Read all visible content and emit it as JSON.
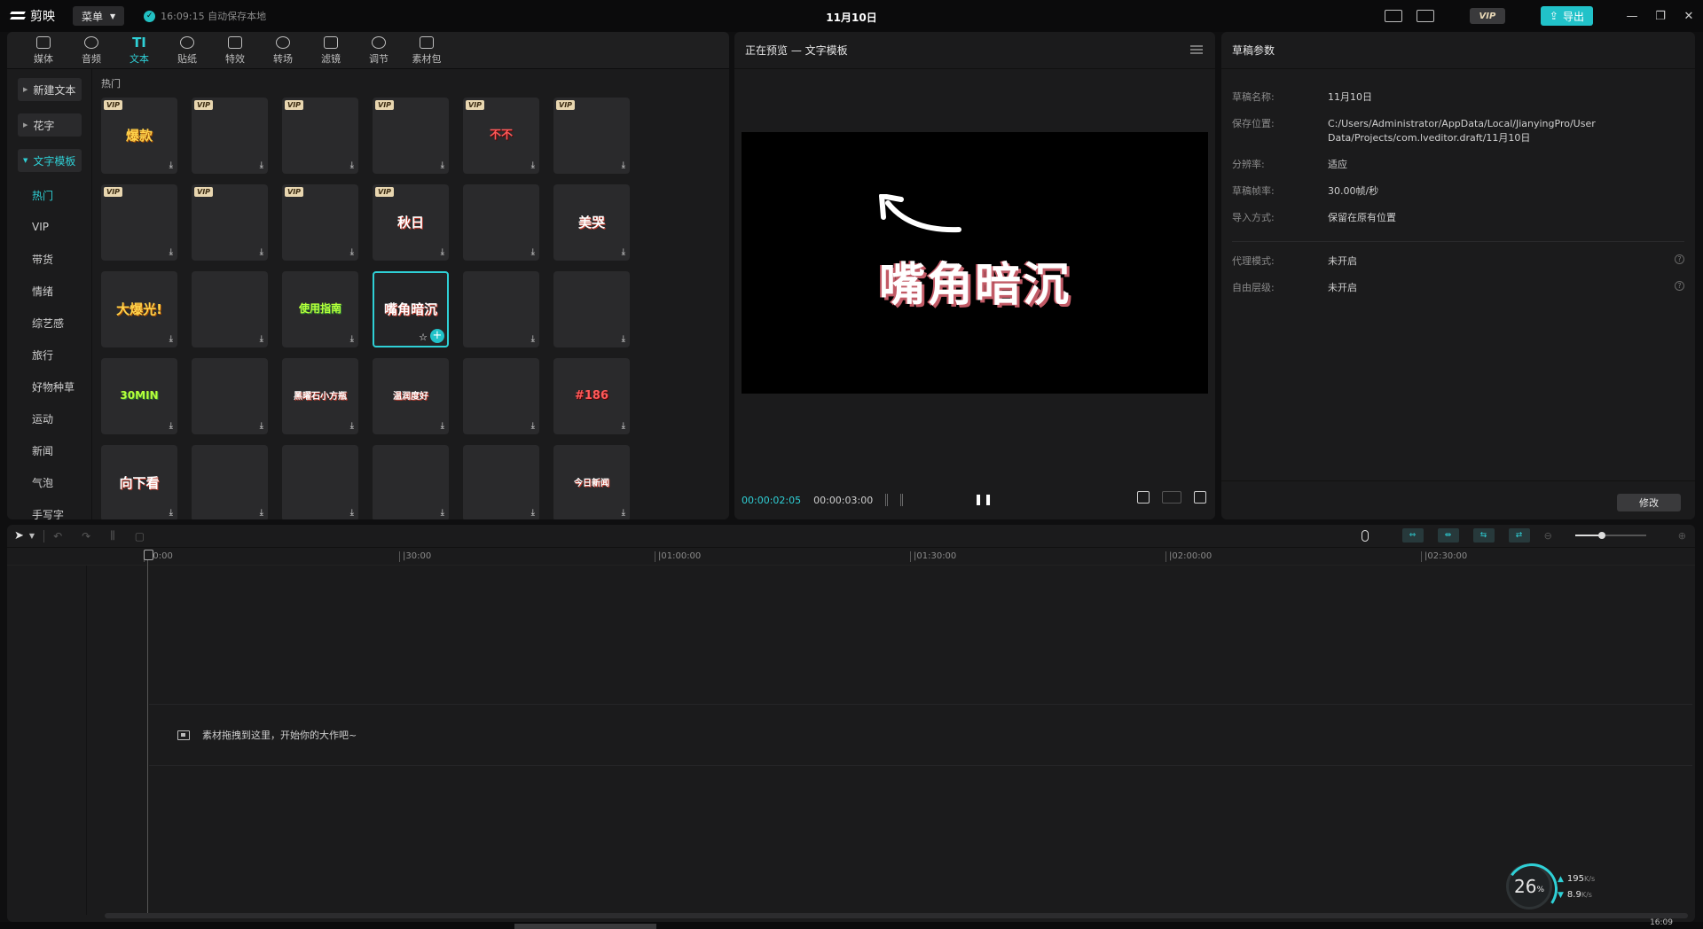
{
  "titlebar": {
    "app_name": "剪映",
    "menu_label": "菜单",
    "autosave_text": "16:09:15 自动保存本地",
    "window_title": "11月10日",
    "vip_label": "VIP",
    "export_label": "导出"
  },
  "tool_tabs": [
    {
      "label": "媒体",
      "icon": "media-icon"
    },
    {
      "label": "音频",
      "icon": "audio-icon"
    },
    {
      "label": "文本",
      "icon": "text-icon",
      "active": true
    },
    {
      "label": "贴纸",
      "icon": "sticker-icon"
    },
    {
      "label": "特效",
      "icon": "effects-icon"
    },
    {
      "label": "转场",
      "icon": "transition-icon"
    },
    {
      "label": "滤镜",
      "icon": "filter-icon"
    },
    {
      "label": "调节",
      "icon": "adjust-icon"
    },
    {
      "label": "素材包",
      "icon": "asset-pack-icon"
    }
  ],
  "side_nav": {
    "new_text": "新建文本",
    "fancy_text": "花字",
    "text_template": "文字模板",
    "sub_items": [
      "热门",
      "VIP",
      "带货",
      "情绪",
      "综艺感",
      "旅行",
      "好物种草",
      "运动",
      "新闻",
      "气泡",
      "手写字"
    ]
  },
  "content": {
    "section_title": "热门",
    "vip_tag": "VIP",
    "tiles": [
      {
        "text": "爆款",
        "vip": true,
        "style": "gold"
      },
      {
        "text": "",
        "vip": true
      },
      {
        "text": "",
        "vip": true,
        "style": "green"
      },
      {
        "text": "",
        "vip": true
      },
      {
        "text": "不不",
        "vip": true,
        "style": "red"
      },
      {
        "text": "",
        "vip": true
      },
      {
        "text": "",
        "vip": true,
        "style": "gold"
      },
      {
        "text": "",
        "vip": true
      },
      {
        "text": "",
        "vip": true
      },
      {
        "text": "秋日",
        "vip": true
      },
      {
        "text": "",
        "vip": false
      },
      {
        "text": "美哭",
        "vip": false
      },
      {
        "text": "大爆光!",
        "vip": false,
        "style": "gold"
      },
      {
        "text": "",
        "vip": false
      },
      {
        "text": "使用指南",
        "vip": false,
        "style": "green"
      },
      {
        "text": "嘴角暗沉",
        "vip": false,
        "selected": true
      },
      {
        "text": "",
        "vip": false
      },
      {
        "text": "",
        "vip": false
      },
      {
        "text": "30MIN",
        "vip": false,
        "style": "green"
      },
      {
        "text": "",
        "vip": false
      },
      {
        "text": "黑曜石小方瓶",
        "vip": false,
        "style": "small"
      },
      {
        "text": "温润度好",
        "vip": false,
        "style": "small"
      },
      {
        "text": "",
        "vip": false
      },
      {
        "text": "#186",
        "vip": false,
        "style": "red"
      },
      {
        "text": "向下看",
        "vip": false
      },
      {
        "text": "",
        "vip": false,
        "style": "gold"
      },
      {
        "text": "",
        "vip": false
      },
      {
        "text": "",
        "vip": false
      },
      {
        "text": "",
        "vip": false
      },
      {
        "text": "今日新闻",
        "vip": false,
        "style": "small"
      }
    ]
  },
  "preview": {
    "title": "正在预览 — 文字模板",
    "canvas_text": "嘴角暗沉",
    "current_time": "00:00:02:05",
    "total_time": "00:00:03:00"
  },
  "params": {
    "title": "草稿参数",
    "rows": [
      {
        "k": "草稿名称:",
        "v": "11月10日"
      },
      {
        "k": "保存位置:",
        "v": "C:/Users/Administrator/AppData/Local/JianyingPro/User Data/Projects/com.lveditor.draft/11月10日"
      },
      {
        "k": "分辨率:",
        "v": "适应"
      },
      {
        "k": "草稿帧率:",
        "v": "30.00帧/秒"
      },
      {
        "k": "导入方式:",
        "v": "保留在原有位置"
      }
    ],
    "rows2": [
      {
        "k": "代理模式:",
        "v": "未开启"
      },
      {
        "k": "自由层级:",
        "v": "未开启"
      }
    ],
    "modify_label": "修改"
  },
  "timeline": {
    "ruler_ticks": [
      "00:00",
      "|30:00",
      "|01:00:00",
      "|01:30:00",
      "|02:00:00",
      "|02:30:00"
    ],
    "drop_hint": "素材拖拽到这里，开始你的大作吧~"
  },
  "network": {
    "percent": "26",
    "percent_unit": "%",
    "up_speed": "195",
    "up_unit": "K/s",
    "down_speed": "8.9",
    "down_unit": "K/s"
  },
  "statusbar": {
    "clock": "16:09"
  }
}
